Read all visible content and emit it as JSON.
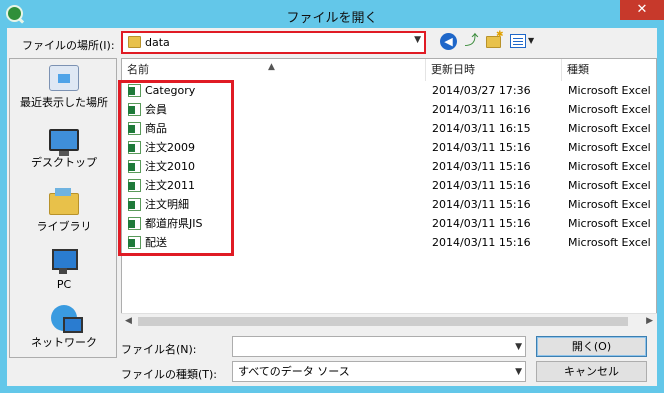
{
  "window": {
    "title": "ファイルを開く",
    "close_symbol": "✕"
  },
  "toolbar": {
    "location_label": "ファイルの場所(I):",
    "location_value": "data",
    "icons": [
      "back-icon",
      "up-folder-icon",
      "new-folder-icon",
      "view-menu-icon"
    ]
  },
  "places": [
    {
      "label": "最近表示した場所",
      "icon": "recent-places-icon"
    },
    {
      "label": "デスクトップ",
      "icon": "desktop-icon"
    },
    {
      "label": "ライブラリ",
      "icon": "library-icon"
    },
    {
      "label": "PC",
      "icon": "pc-icon"
    },
    {
      "label": "ネットワーク",
      "icon": "network-icon"
    }
  ],
  "file_list": {
    "columns": {
      "name": "名前",
      "date": "更新日時",
      "type": "種類"
    },
    "rows": [
      {
        "name": "Category",
        "date": "2014/03/27 17:36",
        "type": "Microsoft Excel"
      },
      {
        "name": "会員",
        "date": "2014/03/11 16:16",
        "type": "Microsoft Excel"
      },
      {
        "name": "商品",
        "date": "2014/03/11 16:15",
        "type": "Microsoft Excel"
      },
      {
        "name": "注文2009",
        "date": "2014/03/11 15:16",
        "type": "Microsoft Excel"
      },
      {
        "name": "注文2010",
        "date": "2014/03/11 15:16",
        "type": "Microsoft Excel"
      },
      {
        "name": "注文2011",
        "date": "2014/03/11 15:16",
        "type": "Microsoft Excel"
      },
      {
        "name": "注文明細",
        "date": "2014/03/11 15:16",
        "type": "Microsoft Excel"
      },
      {
        "name": "都道府県JIS",
        "date": "2014/03/11 15:16",
        "type": "Microsoft Excel"
      },
      {
        "name": "配送",
        "date": "2014/03/11 15:16",
        "type": "Microsoft Excel"
      }
    ]
  },
  "footer": {
    "filename_label": "ファイル名(N):",
    "filename_value": "",
    "filetype_label": "ファイルの種類(T):",
    "filetype_value": "すべてのデータ ソース",
    "open_button": "開く(O)",
    "cancel_button": "キャンセル"
  },
  "colors": {
    "highlight": "#e01b24",
    "frame": "#63c7e9",
    "close": "#c7392b"
  }
}
